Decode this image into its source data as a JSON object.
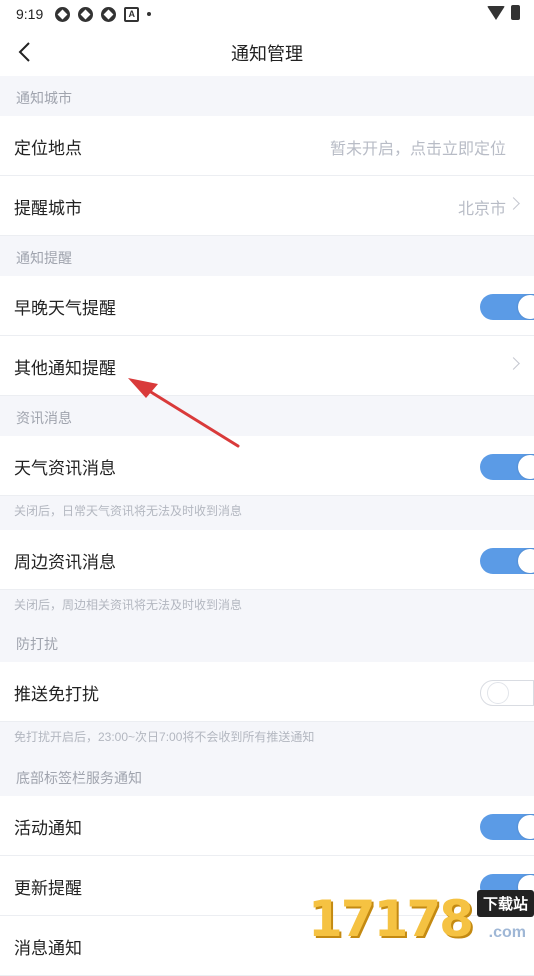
{
  "status_bar": {
    "time": "9:19"
  },
  "nav": {
    "title": "通知管理"
  },
  "sections": {
    "city": {
      "header": "通知城市",
      "location_label": "定位地点",
      "location_value": "暂未开启，点击立即定位",
      "city_label": "提醒城市",
      "city_value": "北京市"
    },
    "reminder": {
      "header": "通知提醒",
      "morning_label": "早晚天气提醒",
      "morning_on": true,
      "other_label": "其他通知提醒"
    },
    "news": {
      "header": "资讯消息",
      "weather_news_label": "天气资讯消息",
      "weather_news_on": true,
      "weather_news_note": "关闭后，日常天气资讯将无法及时收到消息",
      "nearby_news_label": "周边资讯消息",
      "nearby_news_on": true,
      "nearby_news_note": "关闭后，周边相关资讯将无法及时收到消息"
    },
    "dnd": {
      "header": "防打扰",
      "push_dnd_label": "推送免打扰",
      "push_dnd_on": false,
      "push_dnd_note": "免打扰开启后，23:00~次日7:00将不会收到所有推送通知"
    },
    "tabbar": {
      "header": "底部标签栏服务通知",
      "activity_label": "活动通知",
      "activity_on": true,
      "update_label": "更新提醒",
      "update_on": true,
      "message_label": "消息通知"
    }
  },
  "watermark": {
    "number": "17178",
    "download": "下载站",
    "domain": ".com"
  },
  "colors": {
    "accent": "#5b9be6",
    "annotation_arrow": "#d93a3a",
    "background": "#f5f6fa"
  }
}
